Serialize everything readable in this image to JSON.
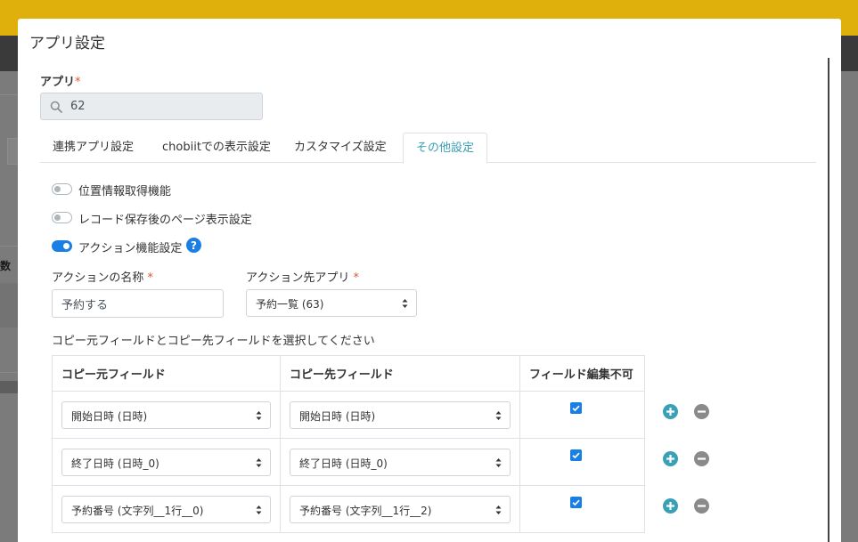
{
  "modal": {
    "title": "アプリ設定",
    "app_field": {
      "label": "アプリ",
      "required_mark": "*",
      "value": "62"
    },
    "tabs": [
      {
        "label": "連携アプリ設定",
        "active": false
      },
      {
        "label": "chobiitでの表示設定",
        "active": false
      },
      {
        "label": "カスタマイズ設定",
        "active": false
      },
      {
        "label": "その他設定",
        "active": true
      }
    ],
    "toggles": [
      {
        "label": "位置情報取得機能",
        "on": false
      },
      {
        "label": "レコード保存後のページ表示設定",
        "on": false
      },
      {
        "label": "アクション機能設定",
        "on": true
      }
    ],
    "action_name": {
      "label": "アクションの名称",
      "required_mark": "*",
      "value": "予約する"
    },
    "action_target": {
      "label": "アクション先アプリ",
      "required_mark": "*",
      "selected": "予約一覧 (63)"
    },
    "instruction": "コピー元フィールドとコピー先フィールドを選択してください",
    "table": {
      "headers": [
        "コピー元フィールド",
        "コピー先フィールド",
        "フィールド編集不可"
      ],
      "rows": [
        {
          "source": "開始日時 (日時)",
          "dest": "開始日時 (日時)",
          "locked": true
        },
        {
          "source": "終了日時 (日時_0)",
          "dest": "終了日時 (日時_0)",
          "locked": true
        },
        {
          "source": "予約番号 (文字列__1行__0)",
          "dest": "予約番号 (文字列__1行__2)",
          "locked": true
        }
      ]
    }
  },
  "background": {
    "partial_header": "数"
  },
  "colors": {
    "accent": "#1a7fe5",
    "tab_active": "#3aa0b5",
    "add_icon": "#3aa0b5",
    "remove_icon": "#8a8a8a",
    "required": "#e2552d"
  },
  "icons": [
    "search-icon",
    "help-icon",
    "check-icon",
    "add-circle-icon",
    "remove-circle-icon",
    "select-arrows-icon"
  ]
}
